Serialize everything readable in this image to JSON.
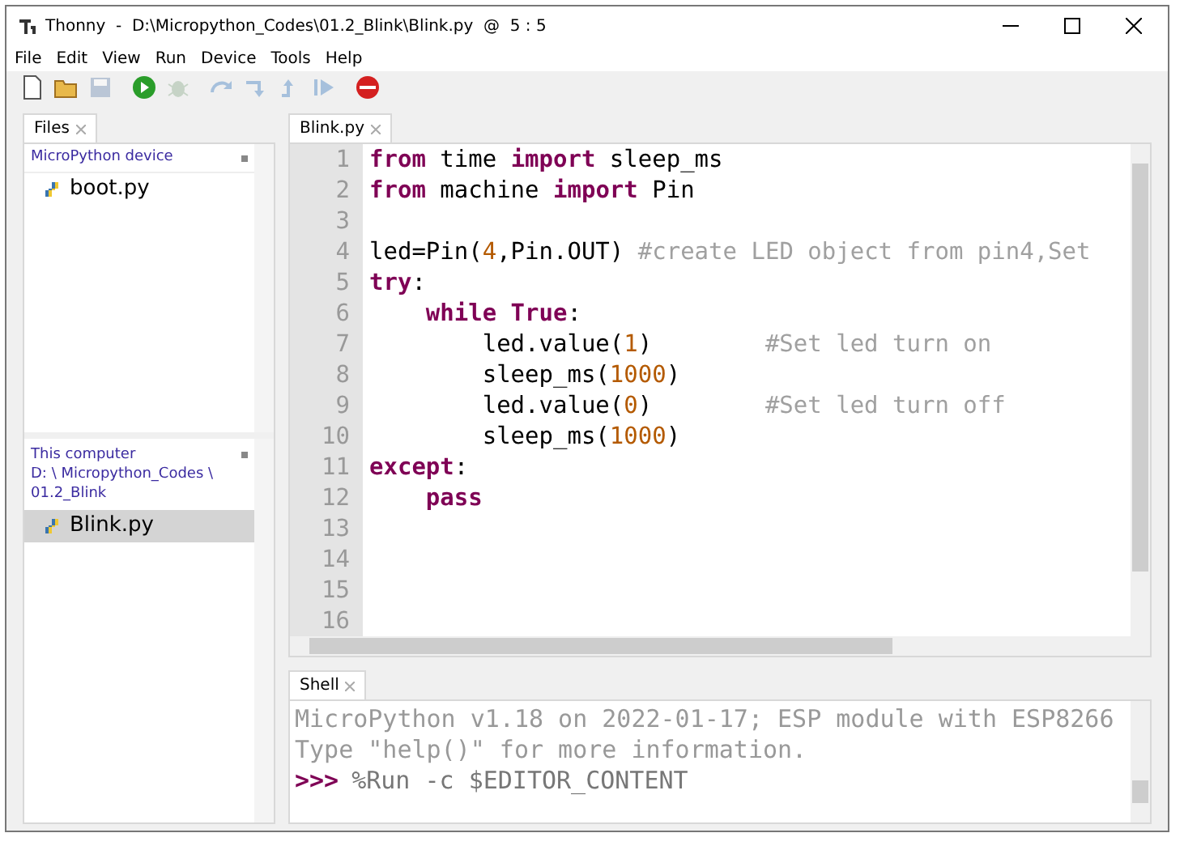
{
  "window": {
    "title": "Thonny  -  D:\\Micropython_Codes\\01.2_Blink\\Blink.py  @  5 : 5"
  },
  "menu": [
    "File",
    "Edit",
    "View",
    "Run",
    "Device",
    "Tools",
    "Help"
  ],
  "toolbar": [
    {
      "kind": "new",
      "disabled": false
    },
    {
      "kind": "open",
      "disabled": false
    },
    {
      "kind": "save",
      "disabled": true
    },
    {
      "kind": "run",
      "disabled": false
    },
    {
      "kind": "debug",
      "disabled": true
    },
    {
      "kind": "step-over",
      "disabled": true
    },
    {
      "kind": "step-into",
      "disabled": true
    },
    {
      "kind": "step-out",
      "disabled": true
    },
    {
      "kind": "resume",
      "disabled": true
    },
    {
      "kind": "stop",
      "disabled": false
    }
  ],
  "files_panel": {
    "tab": "Files",
    "device": {
      "header": "MicroPython device",
      "files": [
        {
          "name": "boot.py",
          "selected": false
        }
      ]
    },
    "computer": {
      "header": [
        "This computer",
        "D: \\ Micropython_Codes \\",
        "01.2_Blink"
      ],
      "files": [
        {
          "name": "Blink.py",
          "selected": true
        }
      ]
    }
  },
  "editor": {
    "tab": "Blink.py",
    "lines": [
      {
        "number": "1",
        "tokens": [
          {
            "kind": "keyword",
            "text": "from"
          },
          {
            "kind": "plain",
            "text": " time "
          },
          {
            "kind": "keyword",
            "text": "import"
          },
          {
            "kind": "plain",
            "text": " sleep_ms"
          }
        ]
      },
      {
        "number": "2",
        "tokens": [
          {
            "kind": "keyword",
            "text": "from"
          },
          {
            "kind": "plain",
            "text": " machine "
          },
          {
            "kind": "keyword",
            "text": "import"
          },
          {
            "kind": "plain",
            "text": " Pin"
          }
        ]
      },
      {
        "number": "3"
      },
      {
        "number": "4",
        "tokens": [
          {
            "kind": "plain",
            "text": "led=Pin("
          },
          {
            "kind": "number",
            "text": "4"
          },
          {
            "kind": "plain",
            "text": ",Pin.OUT) "
          },
          {
            "kind": "comment",
            "text": "#create LED object from pin4,Set"
          }
        ]
      },
      {
        "number": "5",
        "tokens": [
          {
            "kind": "keyword",
            "text": "try"
          },
          {
            "kind": "plain",
            "text": ":"
          }
        ]
      },
      {
        "number": "6",
        "tokens": [
          {
            "kind": "keyword",
            "text": "    while"
          },
          {
            "kind": "keyword",
            "text": " True"
          },
          {
            "kind": "plain",
            "text": ":"
          }
        ]
      },
      {
        "number": "7",
        "tokens": [
          {
            "kind": "plain",
            "text": "        led.value("
          },
          {
            "kind": "number",
            "text": "1"
          },
          {
            "kind": "plain",
            "text": ")        "
          },
          {
            "kind": "comment",
            "text": "#Set led turn on"
          }
        ]
      },
      {
        "number": "8",
        "tokens": [
          {
            "kind": "plain",
            "text": "        sleep_ms("
          },
          {
            "kind": "number",
            "text": "1000"
          },
          {
            "kind": "plain",
            "text": ")"
          }
        ]
      },
      {
        "number": "9",
        "tokens": [
          {
            "kind": "plain",
            "text": "        led.value("
          },
          {
            "kind": "number",
            "text": "0"
          },
          {
            "kind": "plain",
            "text": ")        "
          },
          {
            "kind": "comment",
            "text": "#Set led turn off"
          }
        ]
      },
      {
        "number": "10",
        "tokens": [
          {
            "kind": "plain",
            "text": "        sleep_ms("
          },
          {
            "kind": "number",
            "text": "1000"
          },
          {
            "kind": "plain",
            "text": ")"
          }
        ]
      },
      {
        "number": "11",
        "tokens": [
          {
            "kind": "keyword",
            "text": "except"
          },
          {
            "kind": "plain",
            "text": ":"
          }
        ]
      },
      {
        "number": "12",
        "tokens": [
          {
            "kind": "keyword",
            "text": "    pass"
          }
        ]
      },
      {
        "number": "13"
      },
      {
        "number": "14"
      },
      {
        "number": "15"
      },
      {
        "number": "16"
      }
    ]
  },
  "shell": {
    "tab": "Shell",
    "lines": [
      {
        "kind": "output",
        "text": "MicroPython v1.18 on 2022-01-17; ESP module with ESP8266"
      },
      {
        "kind": "output",
        "text": "Type \"help()\" for more information."
      },
      {
        "kind": "prompt",
        "prompt": ">>>",
        "text": "%Run -c $EDITOR_CONTENT"
      }
    ]
  }
}
